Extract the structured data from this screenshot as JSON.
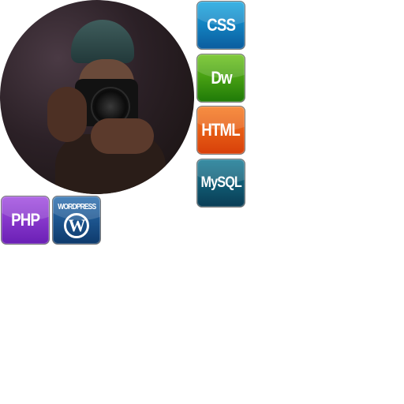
{
  "profile": {
    "alt": "portrait"
  },
  "skills": [
    {
      "label": "CSS",
      "color": "#0a7fc4"
    },
    {
      "label": "Dw",
      "color": "#3c9a10"
    },
    {
      "label": "HTML",
      "color": "#e4520f"
    },
    {
      "label": "MySQL",
      "color": "#0d5570"
    },
    {
      "label": "PHP",
      "color": "#7d28c8"
    },
    {
      "label": "WORDPRESS",
      "logo": "W",
      "color": "#1a4f86"
    }
  ]
}
